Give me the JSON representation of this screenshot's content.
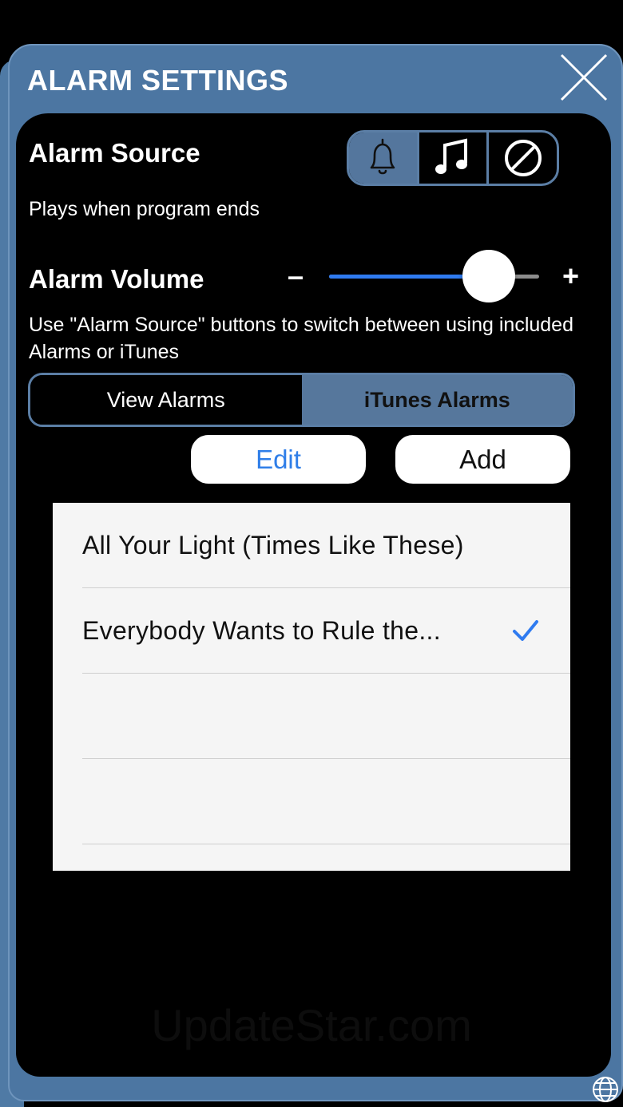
{
  "panel": {
    "title": "ALARM SETTINGS"
  },
  "alarm_source": {
    "label": "Alarm Source",
    "subtitle": "Plays when program ends",
    "buttons": [
      {
        "icon": "bell-icon",
        "active": true
      },
      {
        "icon": "music-note-icon",
        "active": false
      },
      {
        "icon": "no-symbol-icon",
        "active": false
      }
    ]
  },
  "alarm_volume": {
    "label": "Alarm Volume",
    "minus": "–",
    "plus": "+",
    "level": 0.76,
    "help": "Use \"Alarm Source\" buttons to switch between using included Alarms or iTunes"
  },
  "tabs": {
    "view_alarms": "View Alarms",
    "itunes_alarms": "iTunes Alarms",
    "selected": "iTunes Alarms"
  },
  "actions": {
    "edit": "Edit",
    "add": "Add"
  },
  "songs": [
    {
      "title": "All Your Light (Times Like These)",
      "checked": false
    },
    {
      "title": "Everybody Wants to Rule the...",
      "checked": true
    },
    {
      "title": "",
      "checked": false
    },
    {
      "title": "",
      "checked": false
    }
  ],
  "watermark": "UpdateStar.com",
  "colors": {
    "panel": "#4c76a2",
    "accent_blue": "#2f7bf0",
    "edit_text": "#2f7ee8",
    "segment_active": "#56779c"
  }
}
